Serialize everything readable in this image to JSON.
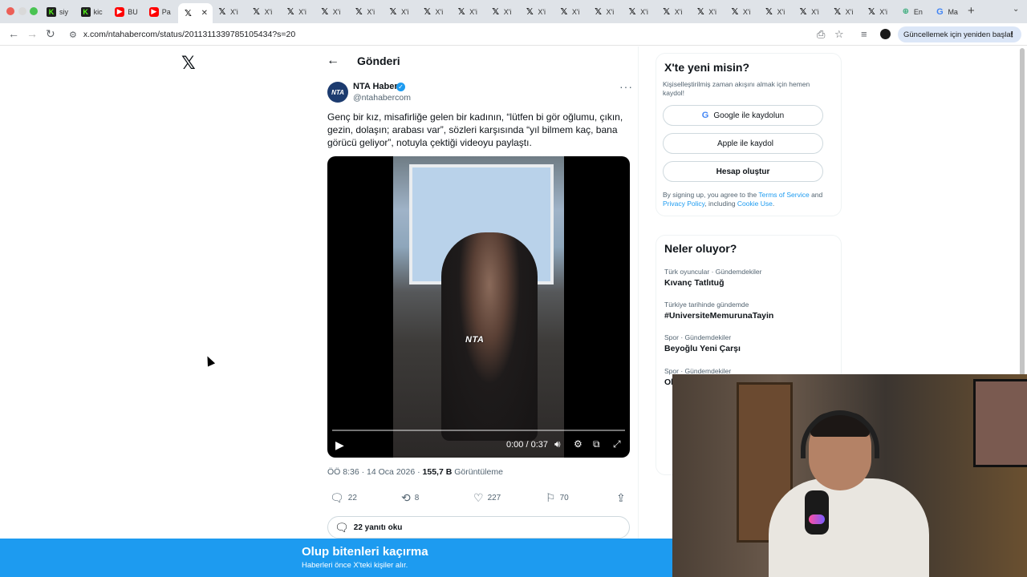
{
  "browser": {
    "tabs": [
      {
        "icon": "kick-icon",
        "glyph": "K",
        "label": "siy"
      },
      {
        "icon": "kick-icon",
        "glyph": "K",
        "label": "kic"
      },
      {
        "icon": "youtube-icon",
        "glyph": "▶",
        "label": "BU"
      },
      {
        "icon": "youtube-icon",
        "glyph": "▶",
        "label": "Pa"
      },
      {
        "icon": "x-icon",
        "glyph": "𝕏",
        "label": "",
        "active": true
      },
      {
        "icon": "x-icon",
        "glyph": "𝕏",
        "label": "X'i"
      },
      {
        "icon": "x-icon",
        "glyph": "𝕏",
        "label": "X'i"
      },
      {
        "icon": "x-icon",
        "glyph": "𝕏",
        "label": "X'i"
      },
      {
        "icon": "x-icon",
        "glyph": "𝕏",
        "label": "X'i"
      },
      {
        "icon": "x-icon",
        "glyph": "𝕏",
        "label": "X'i"
      },
      {
        "icon": "x-icon",
        "glyph": "𝕏",
        "label": "X'i"
      },
      {
        "icon": "x-icon",
        "glyph": "𝕏",
        "label": "X'i"
      },
      {
        "icon": "x-icon",
        "glyph": "𝕏",
        "label": "X'i"
      },
      {
        "icon": "x-icon",
        "glyph": "𝕏",
        "label": "X'i"
      },
      {
        "icon": "x-icon",
        "glyph": "𝕏",
        "label": "X'i"
      },
      {
        "icon": "x-icon",
        "glyph": "𝕏",
        "label": "X'i"
      },
      {
        "icon": "x-icon",
        "glyph": "𝕏",
        "label": "X'i"
      },
      {
        "icon": "x-icon",
        "glyph": "𝕏",
        "label": "X'i"
      },
      {
        "icon": "x-icon",
        "glyph": "𝕏",
        "label": "X'i"
      },
      {
        "icon": "x-icon",
        "glyph": "𝕏",
        "label": "X'i"
      },
      {
        "icon": "x-icon",
        "glyph": "𝕏",
        "label": "X'i"
      },
      {
        "icon": "x-icon",
        "glyph": "𝕏",
        "label": "X'i"
      },
      {
        "icon": "x-icon",
        "glyph": "𝕏",
        "label": "X'i"
      },
      {
        "icon": "x-icon",
        "glyph": "𝕏",
        "label": "X'i"
      },
      {
        "icon": "x-icon",
        "glyph": "𝕏",
        "label": "X'i"
      },
      {
        "icon": "globe-icon",
        "glyph": "⊕",
        "label": "En"
      },
      {
        "icon": "google-icon",
        "glyph": "G",
        "label": "Ma"
      }
    ],
    "url": "x.com/ntahabercom/status/2011311339785105434?s=20",
    "relaunch_label": "Güncellemek için yeniden başlat"
  },
  "post": {
    "header_title": "Gönderi",
    "author_name": "NTA Haber",
    "author_handle": "@ntahabercom",
    "avatar_text": "NTA",
    "text": "Genç bir kız, misafirliğe gelen bir kadının, “lütfen bi gör oğlumu, çıkın, gezin, dolaşın; arabası var”, sözleri karşısında “yıl bilmem kaç, bana görücü geliyor”, notuyla çektiği videoyu paylaştı.",
    "video": {
      "watermark": "NTA",
      "time": "0:00 / 0:37",
      "progress": 0
    },
    "time": "ÖÖ 8:36",
    "date": "14 Oca 2026",
    "views_count": "155,7 B",
    "views_label": "Görüntüleme",
    "replies": "22",
    "reposts": "8",
    "likes": "227",
    "bookmarks": "70",
    "read_replies_label": "22 yanıtı oku"
  },
  "signup": {
    "title": "X'te yeni misin?",
    "subtitle": "Kişiselleştirilmiş zaman akışını almak için hemen kaydol!",
    "google_label": "Google ile kaydolun",
    "apple_label": "Apple ile kaydol",
    "create_label": "Hesap oluştur",
    "terms_prefix": "By signing up, you agree to the ",
    "terms_link": "Terms of Service",
    "terms_mid": " and ",
    "privacy_link": "Privacy Policy",
    "terms_mid2": ", including ",
    "cookie_link": "Cookie Use",
    "terms_end": "."
  },
  "trends": {
    "title": "Neler oluyor?",
    "items": [
      {
        "category": "Türk oyuncular · Gündemdekiler",
        "name": "Kıvanç Tatlıtuğ"
      },
      {
        "category": "Türkiye tarihinde gündemde",
        "name": "#UniversiteMemurunaTayin"
      },
      {
        "category": "Spor · Gündemdekiler",
        "name": "Beyoğlu Yeni Çarşı"
      },
      {
        "category": "Spor · Gündemdekiler",
        "name": "Ol"
      }
    ]
  },
  "banner": {
    "title": "Olup bitenleri kaçırma",
    "subtitle": "Haberleri önce X'teki kişiler alır."
  },
  "colors": {
    "accent": "#1d9bf0",
    "text": "#0f1419",
    "muted": "#536471"
  }
}
